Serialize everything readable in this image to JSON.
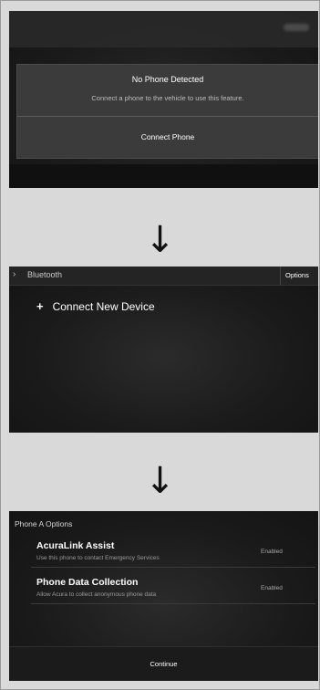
{
  "screen1": {
    "dialog": {
      "title": "No Phone Detected",
      "message": "Connect a phone to the vehicle to use this feature.",
      "button": "Connect Phone"
    }
  },
  "screen2": {
    "header": {
      "chevron": "›",
      "title": "Bluetooth",
      "options": "Options"
    },
    "item": {
      "plus": "+",
      "label": "Connect New Device"
    }
  },
  "screen3": {
    "header": "Phone A Options",
    "rows": [
      {
        "title": "AcuraLink Assist",
        "desc": "Use this phone to contact Emergency Services",
        "status": "Enabled"
      },
      {
        "title": "Phone Data Collection",
        "desc": "Allow Acura to collect anonymous phone data",
        "status": "Enabled"
      }
    ],
    "continue": "Continue"
  },
  "arrows": {
    "glyph": "↓"
  }
}
